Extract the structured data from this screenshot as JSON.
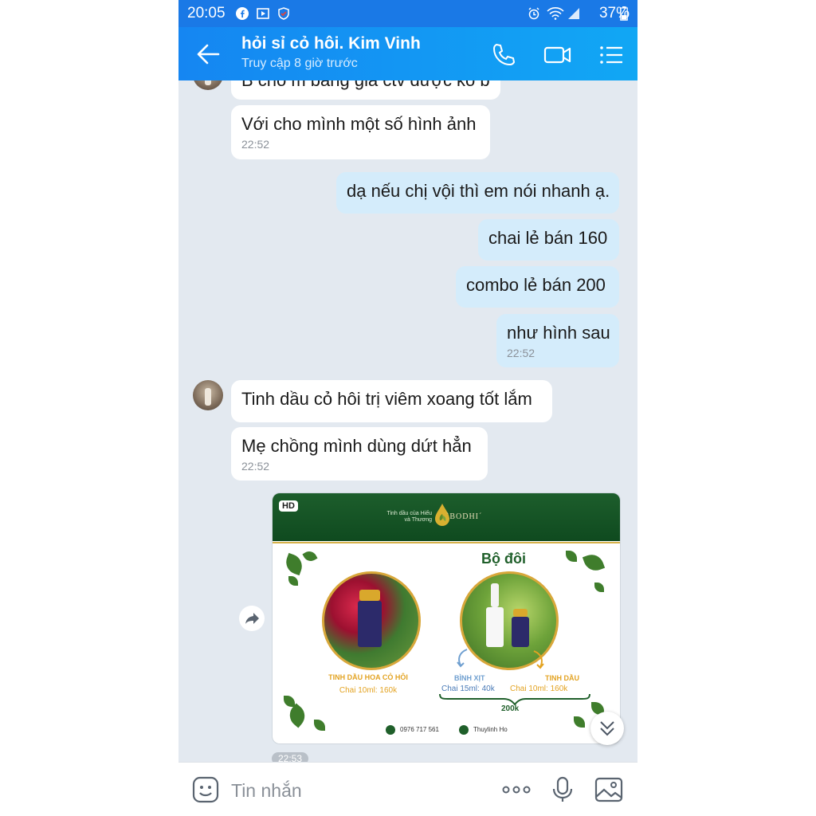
{
  "status_bar": {
    "time": "20:05",
    "battery": "37%",
    "colors": {
      "bar": "#1a79e6"
    }
  },
  "header": {
    "title": "hỏi sỉ cỏ hôi. Kim Vinh",
    "subtitle": "Truy cập 8 giờ trước",
    "icons": [
      "back-arrow-icon",
      "phone-icon",
      "video-call-icon",
      "menu-list-icon"
    ]
  },
  "messages": [
    {
      "side": "in",
      "text": "B cho m bảng giá ctv được ko b"
    },
    {
      "side": "in",
      "text": "Với cho mình một số hình ảnh",
      "time": "22:52"
    },
    {
      "side": "out",
      "text": "dạ nếu chị vội thì em nói nhanh ạ."
    },
    {
      "side": "out",
      "text": "chai lẻ bán 160"
    },
    {
      "side": "out",
      "text": "combo lẻ bán 200"
    },
    {
      "side": "out",
      "text": "như hình sau",
      "time": "22:52"
    },
    {
      "side": "in",
      "text": "Tinh dầu cỏ hôi trị viêm xoang tốt lắm"
    },
    {
      "side": "in",
      "text": "Mẹ chồng mình dùng dứt hẳn",
      "time": "22:52"
    }
  ],
  "image_message": {
    "hd_badge": "HD",
    "tagline": "Tinh dầu của Hiếu và Thương",
    "brand": "`BODHI´",
    "heading": "Bộ đôi",
    "product1_name": "TINH DẦU HOA CỎ HÔI",
    "product1_price": "Chai 10ml: 160k",
    "spray_label": "BÌNH XỊT",
    "oil_label": "TINH DẦU",
    "spray_price": "Chai 15ml: 40k",
    "oil_price": "Chai 10ml: 160k",
    "combo_total": "200k",
    "phone": "0976 717 561",
    "facebook": "Thuylinh Ho",
    "time": "22:53"
  },
  "input_bar": {
    "placeholder": "Tin nhắn",
    "icons": [
      "sticker-icon",
      "more-icon",
      "microphone-icon",
      "image-icon"
    ]
  }
}
